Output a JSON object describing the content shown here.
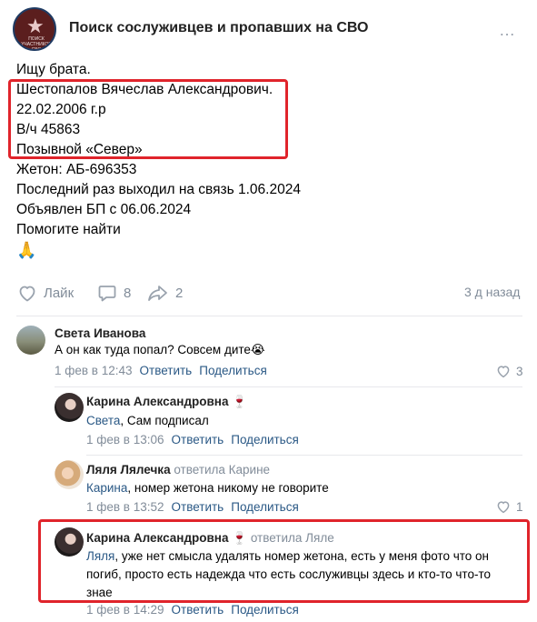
{
  "header": {
    "group_title": "Поиск сослуживцев и пропавших на СВО",
    "logo_line1": "ПОИСК",
    "logo_line2": "УЧАСТНИКОВ СВО",
    "more_icon": "…"
  },
  "post": {
    "lines": [
      "Ищу брата.",
      "Шестопалов Вячеслав Александрович.",
      "22.02.2006 г.р",
      "В/ч 45863",
      "Позывной «Север»",
      "Жетон: АБ-696353",
      "Последний раз выходил на связь 1.06.2024",
      "Объявлен БП с 06.06.2024",
      "Помогите найти"
    ],
    "emoji": "🙏"
  },
  "actions": {
    "like_label": "Лайк",
    "comments_count": "8",
    "shares_count": "2",
    "posted_ago": "3 д назад"
  },
  "comments": [
    {
      "author": "Света Иванова",
      "reply_to": "",
      "text": "А он как туда попал? Совсем дите😭",
      "date": "1 фев в 12:43",
      "reply_label": "Ответить",
      "share_label": "Поделиться",
      "likes": "3"
    },
    {
      "author": "Карина Александровна",
      "badge": "🍷",
      "reply_to": "",
      "mention": "Света",
      "text": ", Сам подписал",
      "date": "1 фев в 13:06",
      "reply_label": "Ответить",
      "share_label": "Поделиться"
    },
    {
      "author": "Ляля Лялечка",
      "reply_to": "ответила Карине",
      "mention": "Карина",
      "text": ", номер жетона никому не говорите",
      "date": "1 фев в 13:52",
      "reply_label": "Ответить",
      "share_label": "Поделиться",
      "likes": "1"
    },
    {
      "author": "Карина Александровна",
      "badge": "🍷",
      "reply_to": "ответила Ляле",
      "mention": "Ляля",
      "text_line1": ", уже нет смысла удалять номер жетона, есть у меня фото что он",
      "text_line2": "погиб, просто есть надежда что есть сослуживцы здесь и кто-то что-то",
      "text_line3": "знае",
      "date": "1 фев в 14:29",
      "reply_label": "Ответить",
      "share_label": "Поделиться"
    }
  ],
  "colors": {
    "highlight_box": "#e0242b",
    "link": "#2a5885",
    "muted": "#818c99"
  }
}
